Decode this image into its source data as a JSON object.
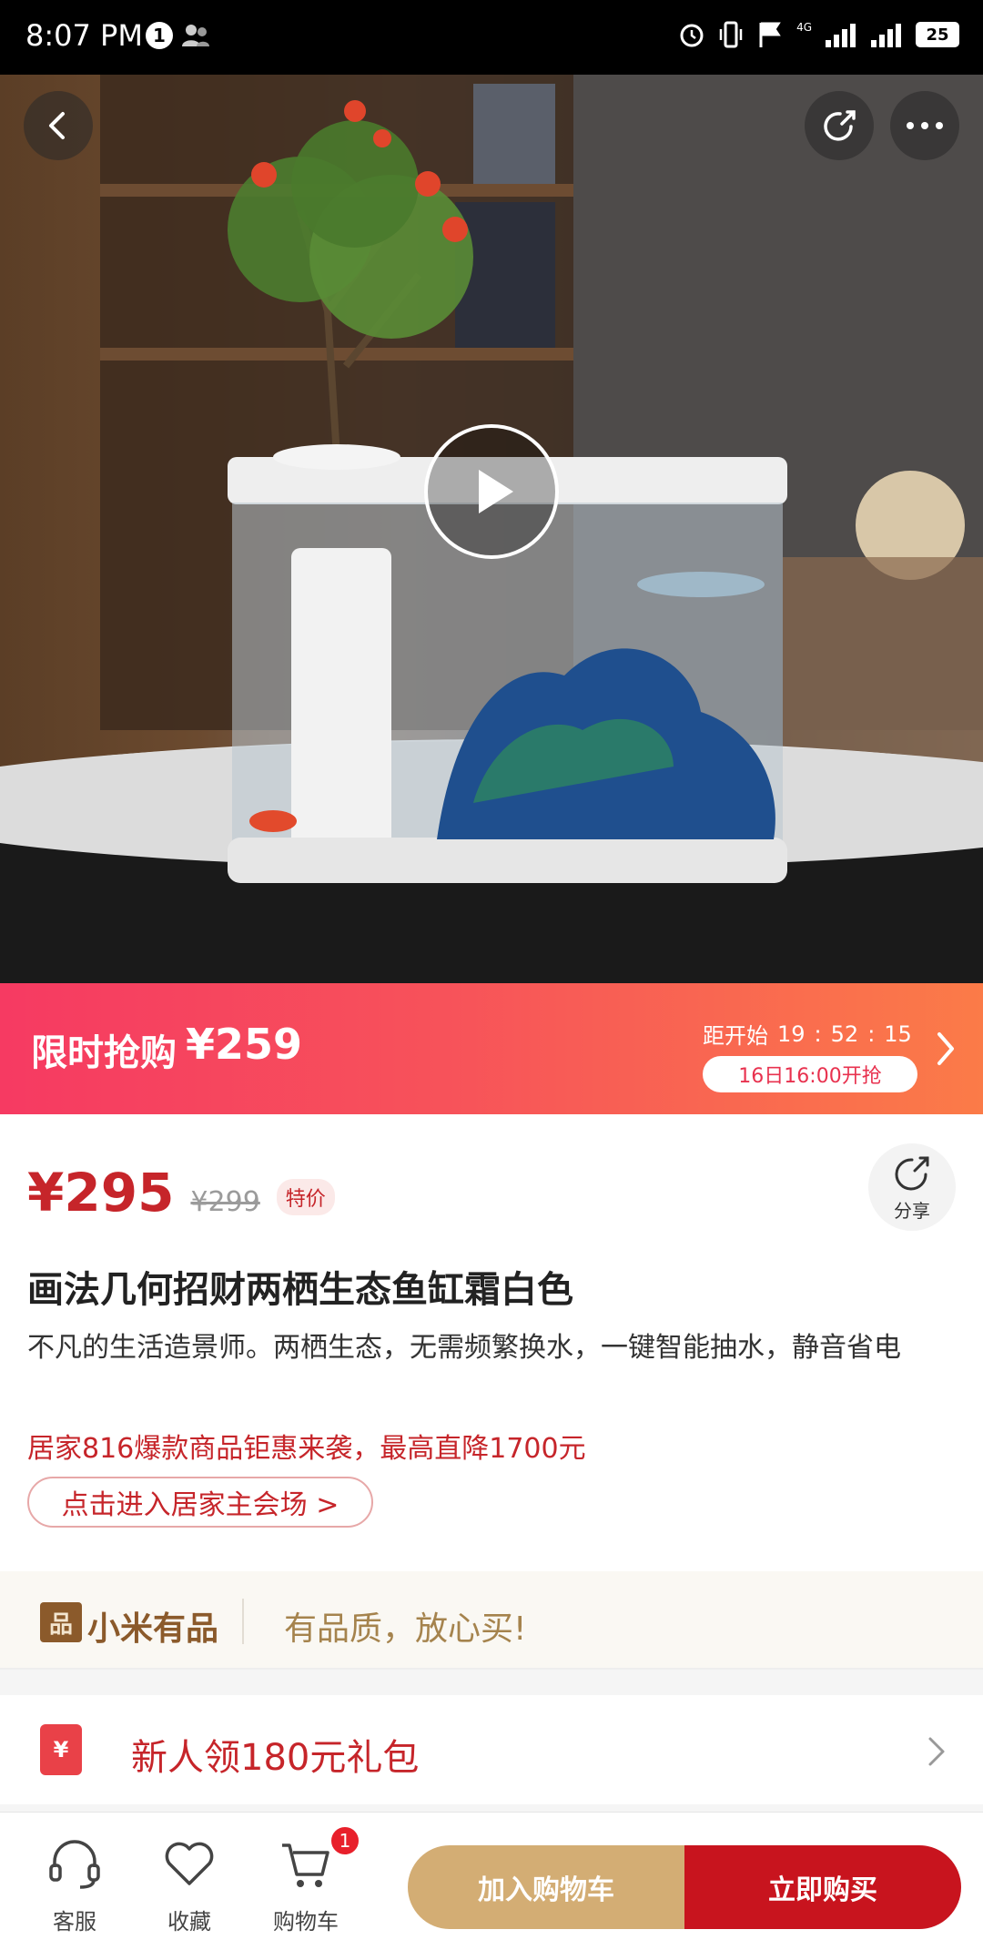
{
  "status_bar": {
    "time": "8:07 PM",
    "notification_badge": "1",
    "battery": "25",
    "network_label": "4G"
  },
  "hero": {
    "icons": [
      "back-arrow-icon",
      "share-icon",
      "more-icon",
      "play-icon"
    ]
  },
  "flash_sale": {
    "title": "限时抢购",
    "price": "¥259",
    "countdown_label": "距开始",
    "hours": "19",
    "minutes": "52",
    "seconds": "15",
    "start_time": "16日16:00开抢"
  },
  "product": {
    "price": "¥295",
    "original_price": "¥299",
    "price_tag": "特价",
    "share_label": "分享",
    "title": "画法几何招财两栖生态鱼缸霜白色",
    "description": "不凡的生活造景师。两栖生态，无需频繁换水，一键智能抽水，静音省电",
    "promo": "居家816爆款商品钜惠来袭，最高直降1700元",
    "promo_link": "点击进入居家主会场 >"
  },
  "youpin": {
    "name": "小米有品",
    "slogan": "有品质，放心买!"
  },
  "gift": {
    "label": "新人领180元礼包",
    "icon_text": "¥"
  },
  "bottom_nav": {
    "service": "客服",
    "favorite": "收藏",
    "cart": "购物车",
    "cart_count": "1",
    "add_to_cart": "加入购物车",
    "buy_now": "立即购买"
  },
  "colors": {
    "price_red": "#c6252a",
    "flash_gradient_start": "#f63a62",
    "flash_gradient_end": "#fb7b48",
    "add_cart_gold": "#d3ad74",
    "buy_red": "#c8141e"
  }
}
